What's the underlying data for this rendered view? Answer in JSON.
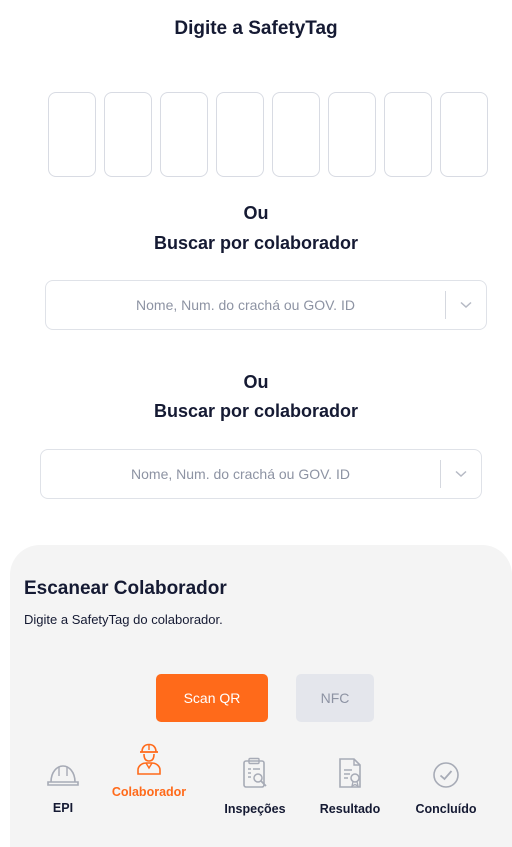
{
  "header": {
    "title": "Digite a SafetyTag"
  },
  "tag_boxes": [
    "",
    "",
    "",
    "",
    "",
    "",
    "",
    ""
  ],
  "search1": {
    "ou": "Ou",
    "label": "Buscar por colaborador",
    "placeholder": "Nome, Num. do crachá ou GOV. ID"
  },
  "search2": {
    "ou": "Ou",
    "label": "Buscar por colaborador",
    "placeholder": "Nome, Num. do crachá ou GOV. ID"
  },
  "sheet": {
    "title": "Escanear Colaborador",
    "subtitle": "Digite a SafetyTag do colaborador.",
    "scan_label": "Scan QR",
    "nfc_label": "NFC"
  },
  "steps": [
    {
      "label": "EPI",
      "icon": "helmet-icon"
    },
    {
      "label": "Colaborador",
      "icon": "worker-icon",
      "active": true
    },
    {
      "label": "Inspeções",
      "icon": "clipboard-search-icon"
    },
    {
      "label": "Resultado",
      "icon": "document-badge-icon"
    },
    {
      "label": "Concluído",
      "icon": "check-circle-icon"
    }
  ],
  "colors": {
    "accent": "#ff6a1a",
    "text": "#151a33",
    "muted": "#8d93a3",
    "sheet_bg": "#f4f4f4"
  }
}
